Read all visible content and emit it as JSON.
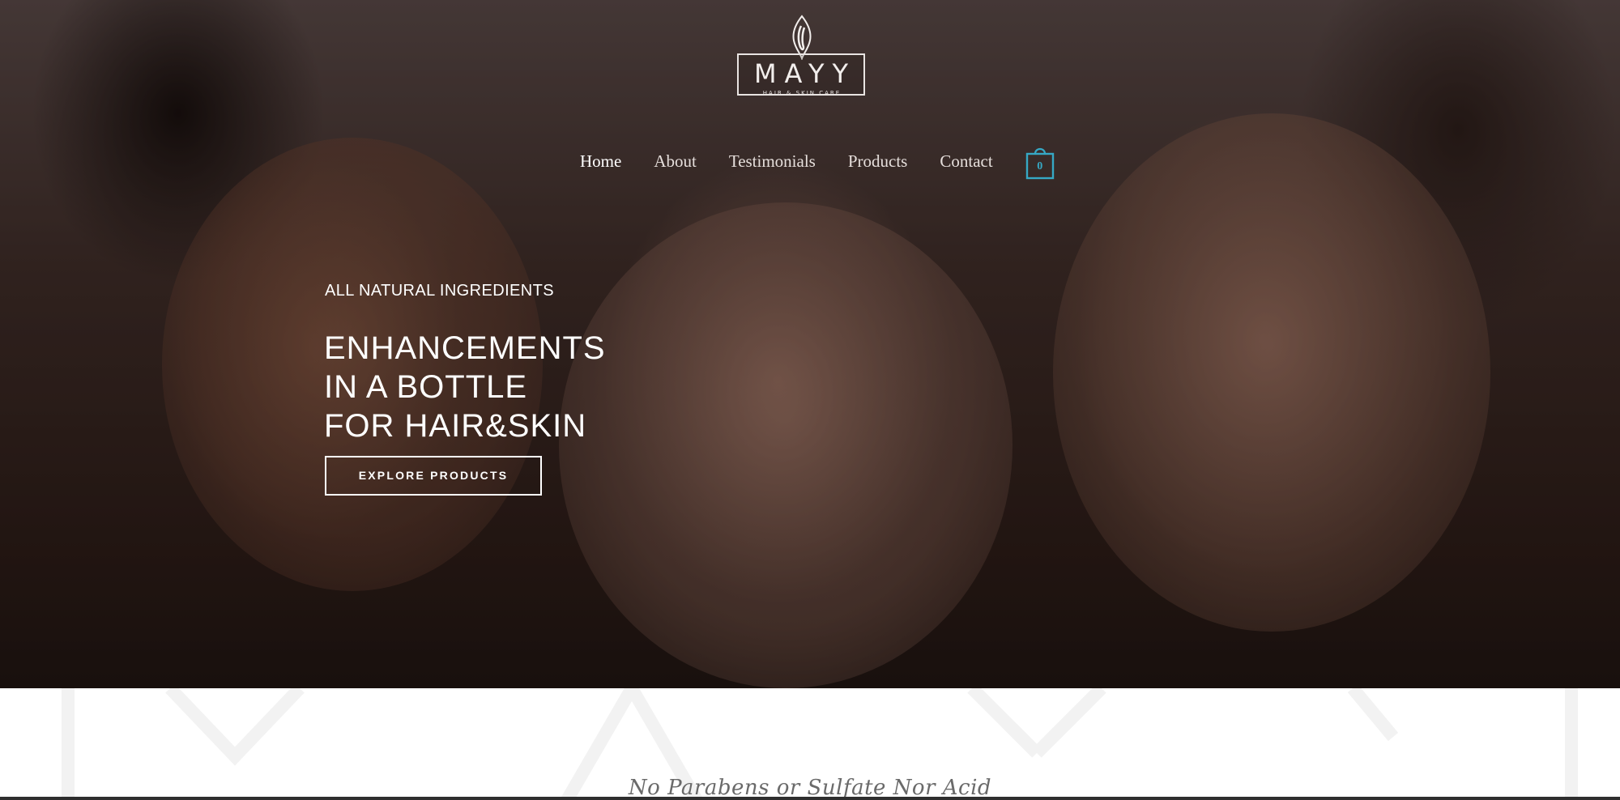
{
  "brand": {
    "name": "MAYY",
    "tagline": "HAIR & SKIN CARE"
  },
  "nav": {
    "items": [
      {
        "label": "Home",
        "active": true
      },
      {
        "label": "About",
        "active": false
      },
      {
        "label": "Testimonials",
        "active": false
      },
      {
        "label": "Products",
        "active": false
      },
      {
        "label": "Contact",
        "active": false
      }
    ],
    "cart": {
      "count": "0",
      "icon": "shopping-bag-icon"
    }
  },
  "hero": {
    "eyebrow": "ALL NATURAL INGREDIENTS",
    "heading_lines": [
      "ENHANCEMENTS",
      "IN A BOTTLE",
      "FOR HAIR&SKIN"
    ],
    "cta_label": "EXPLORE PRODUCTS",
    "image": "three-women-portrait"
  },
  "section": {
    "watermark_text": "MAYY",
    "tagline": "No Parabens or Sulfate Nor Acid"
  },
  "colors": {
    "accent": "#36a8c4",
    "nav_text": "#e6dfdc",
    "hero_text": "#ffffff",
    "tagline": "#6a6a6a",
    "watermark": "#f3f3f3"
  }
}
